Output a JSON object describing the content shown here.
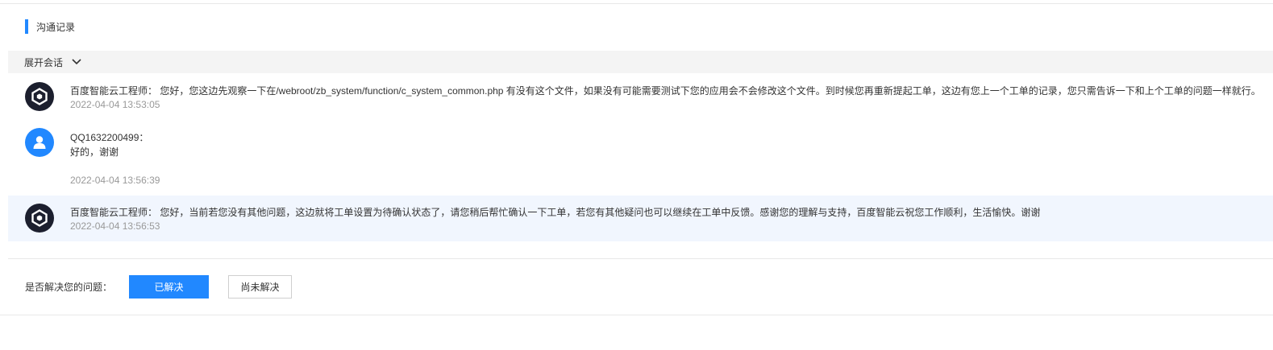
{
  "section": {
    "title": "沟通记录"
  },
  "expand": {
    "label": "展开会话"
  },
  "messages": [
    {
      "avatar": "engineer-avatar-icon",
      "text": "百度智能云工程师： 您好，您这边先观察一下在/webroot/zb_system/function/c_system_common.php 有没有这个文件，如果没有可能需要测试下您的应用会不会修改这个文件。到时候您再重新提起工单，这边有您上一个工单的记录，您只需告诉一下和上个工单的问题一样就行。",
      "time": "2022-04-04 13:53:05"
    },
    {
      "avatar": "user-avatar-icon",
      "sender": "QQ1632200499：",
      "text": "好的，谢谢",
      "time": "2022-04-04 13:56:39"
    },
    {
      "avatar": "engineer-avatar-icon",
      "text": "百度智能云工程师： 您好，当前若您没有其他问题，这边就将工单设置为待确认状态了，请您稍后帮忙确认一下工单，若您有其他疑问也可以继续在工单中反馈。感谢您的理解与支持，百度智能云祝您工作顺利，生活愉快。谢谢",
      "time": "2022-04-04 13:56:53"
    }
  ],
  "resolve": {
    "question": "是否解决您的问题：",
    "resolved_label": "已解决",
    "unresolved_label": "尚未解决"
  },
  "colors": {
    "accent": "#2188ff",
    "engineer_avatar_bg": "#1c1f2e",
    "highlight_bg": "#f1f6fe",
    "timestamp": "#999999"
  }
}
